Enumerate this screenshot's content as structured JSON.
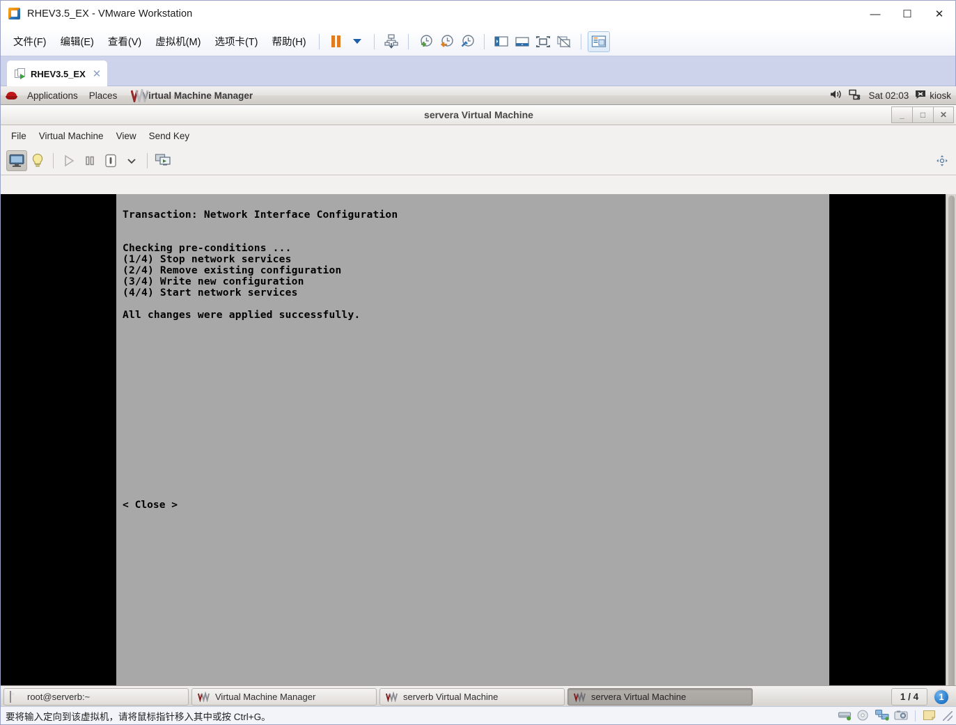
{
  "vmware": {
    "title": "RHEV3.5_EX - VMware Workstation",
    "title_icon": "vmware-app-icon",
    "menus": [
      "文件(F)",
      "编辑(E)",
      "查看(V)",
      "虚拟机(M)",
      "选项卡(T)",
      "帮助(H)"
    ],
    "window_buttons": {
      "minimize": "—",
      "maximize": "☐",
      "close": "✕"
    },
    "toolbar_icons": [
      "pause-icon",
      "dropdown-caret-icon",
      "snapshot-manager-icon",
      "take-snapshot-icon",
      "revert-snapshot-icon",
      "manage-snapshots-icon",
      "show-library-icon",
      "show-thumbnail-bar-icon",
      "fullscreen-icon",
      "unity-mode-icon",
      "console-view-icon"
    ],
    "tab": {
      "label": "RHEV3.5_EX",
      "close": "✕",
      "icon": "vm-tab-icon"
    },
    "statusbar": {
      "text": "要将输入定向到该虚拟机，请将鼠标指针移入其中或按 Ctrl+G。",
      "icons": [
        "harddisk-icon",
        "cdrom-icon",
        "network-icon",
        "camera-icon",
        "notes-icon",
        "resize-grip-icon"
      ]
    }
  },
  "gnome_panel": {
    "logo_icon": "redhat-icon",
    "applications": "Applications",
    "places": "Places",
    "window_title": "Virtual Machine Manager",
    "window_title_logo": "virt-manager-icon",
    "volume_icon": "volume-icon",
    "network_icon": "network-disconnected-icon",
    "clock": "Sat 02:03",
    "user_icon": "user-chat-icon",
    "user": "kiosk"
  },
  "virt_viewer": {
    "title": "servera Virtual Machine",
    "window_buttons": {
      "minimize": "_",
      "maximize": "□",
      "close": "✕"
    },
    "menus": [
      "File",
      "Virtual Machine",
      "View",
      "Send Key"
    ],
    "toolbar_icons": [
      "console-display-icon",
      "show-hint-icon",
      "run-icon",
      "pause-icon",
      "shutdown-icon",
      "shutdown-dropdown-icon",
      "switch-console-icon",
      "move-pointer-icon"
    ]
  },
  "console": {
    "background": "#a8a8a8",
    "foreground": "#000000",
    "lines": [
      "Transaction: Network Interface Configuration",
      "",
      "",
      "Checking pre-conditions ...",
      "(1/4) Stop network services",
      "(2/4) Remove existing configuration",
      "(3/4) Write new configuration",
      "(4/4) Start network services",
      "",
      "All changes were applied successfully."
    ],
    "close_button": "< Close >"
  },
  "taskbar": {
    "items": [
      {
        "label": "root@serverb:~",
        "icon": "terminal-icon",
        "active": false
      },
      {
        "label": "Virtual Machine Manager",
        "icon": "virt-manager-icon",
        "active": false
      },
      {
        "label": "serverb Virtual Machine",
        "icon": "virt-manager-icon",
        "active": false
      },
      {
        "label": "servera Virtual Machine",
        "icon": "virt-manager-icon",
        "active": true
      }
    ],
    "workspace_label": "1 / 4",
    "workspace_badge": "1"
  }
}
